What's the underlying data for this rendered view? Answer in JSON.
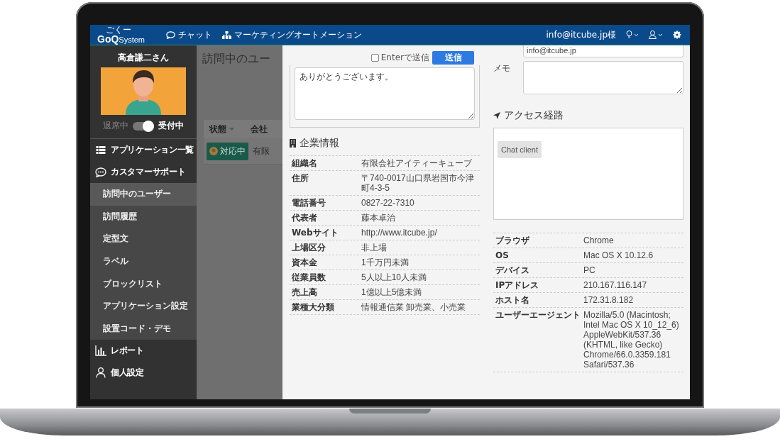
{
  "nav": {
    "logo_ruby": "ごくー",
    "logo_main": "GoQ",
    "logo_sub": "System",
    "items": [
      {
        "label": "チャット"
      },
      {
        "label": "マーケティングオートメーション"
      }
    ],
    "account": "info@itcube.jp様"
  },
  "sidebar": {
    "user_name": "高倉謙二さん",
    "status": {
      "off_label": "退席中",
      "on_label": "受付中",
      "on": true
    },
    "menu": [
      {
        "label": "アプリケーション一覧"
      },
      {
        "label": "カスタマーサポート",
        "children": [
          {
            "label": "訪問中のユーザー",
            "selected": true
          },
          {
            "label": "訪問履歴",
            "selected": false
          },
          {
            "label": "定型文",
            "selected": false
          },
          {
            "label": "ラベル",
            "selected": false
          },
          {
            "label": "ブロックリスト",
            "selected": false
          },
          {
            "label": "アプリケーション設定",
            "selected": false
          },
          {
            "label": "設置コード・デモ",
            "selected": false
          }
        ]
      },
      {
        "label": "レポート"
      },
      {
        "label": "個人設定"
      }
    ]
  },
  "background_page": {
    "title": "訪問中のユー",
    "columns": [
      "状態",
      "会社"
    ],
    "rows": [
      {
        "status": "対応中",
        "company": "有限"
      }
    ]
  },
  "chat": {
    "enter_to_send": {
      "label": "Enterで送信",
      "checked": false
    },
    "send_button": "送信",
    "message": "ありがとうございます。"
  },
  "company_info": {
    "title": "企業情報",
    "rows": [
      {
        "label": "組織名",
        "value": "有限会社アイティーキューブ"
      },
      {
        "label": "住所",
        "value": "〒740-0017山口県岩国市今津町4-3-5"
      },
      {
        "label": "電話番号",
        "value": "0827-22-7310"
      },
      {
        "label": "代表者",
        "value": "藤本卓治"
      },
      {
        "label": "Webサイト",
        "value": "http://www.itcube.jp/"
      },
      {
        "label": "上場区分",
        "value": "非上場"
      },
      {
        "label": "資本金",
        "value": "1千万円未満"
      },
      {
        "label": "従業員数",
        "value": "5人以上10人未満"
      },
      {
        "label": "売上高",
        "value": "1億以上5億未満"
      },
      {
        "label": "業種大分類",
        "value": "情報通信業 卸売業、小売業"
      }
    ]
  },
  "visitor": {
    "email": "info@itcube.jp",
    "memo_label": "メモ"
  },
  "access_route": {
    "title": "アクセス経路",
    "steps": [
      "Chat client"
    ]
  },
  "environment": {
    "rows": [
      {
        "label": "ブラウザ",
        "value": "Chrome"
      },
      {
        "label": "OS",
        "value": "Mac OS X 10.12.6"
      },
      {
        "label": "デバイス",
        "value": "PC"
      },
      {
        "label": "IPアドレス",
        "value": "210.167.116.147"
      },
      {
        "label": "ホスト名",
        "value": "172.31.8.182"
      },
      {
        "label": "ユーザーエージェント",
        "value": "Mozilla/5.0 (Macintosh; Intel Mac OS X 10_12_6) AppleWebKit/537.36 (KHTML, like Gecko) Chrome/66.0.3359.181 Safari/537.36"
      }
    ]
  }
}
